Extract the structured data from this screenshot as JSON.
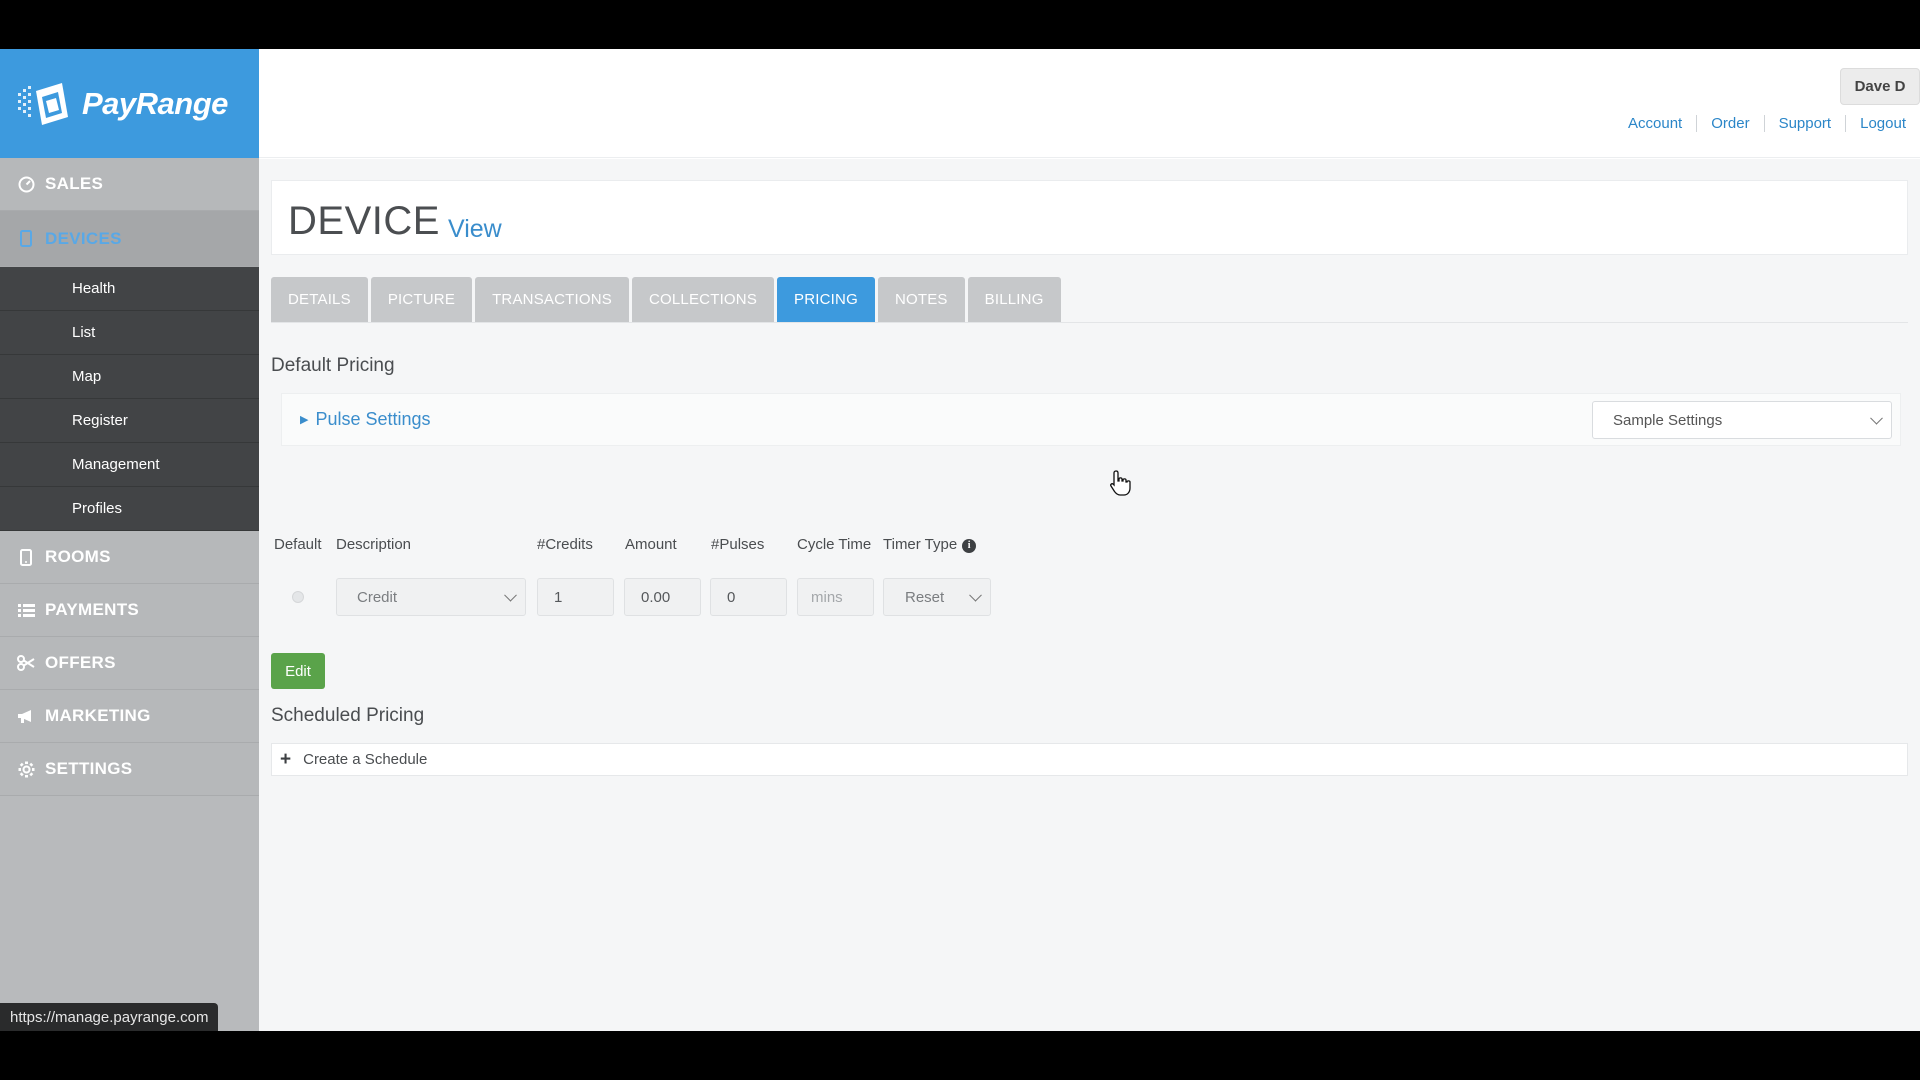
{
  "brand": {
    "name": "PayRange",
    "accent": "#3d9ade"
  },
  "sidebar": {
    "items": [
      {
        "label": "SALES",
        "icon": "dashboard-icon"
      },
      {
        "label": "DEVICES",
        "icon": "device-icon"
      },
      {
        "label": "ROOMS",
        "icon": "phone-icon"
      },
      {
        "label": "PAYMENTS",
        "icon": "list-icon"
      },
      {
        "label": "OFFERS",
        "icon": "scissors-icon"
      },
      {
        "label": "MARKETING",
        "icon": "megaphone-icon"
      },
      {
        "label": "SETTINGS",
        "icon": "gear-icon"
      }
    ],
    "active": "DEVICES",
    "sub_items": [
      "Health",
      "List",
      "Map",
      "Register",
      "Management",
      "Profiles"
    ]
  },
  "status_bar": {
    "url": "https://manage.payrange.com"
  },
  "header": {
    "user": "Dave D",
    "links": [
      "Account",
      "Order",
      "Support",
      "Logout"
    ]
  },
  "page": {
    "title": "DEVICE",
    "subtitle": "View",
    "tabs": [
      "DETAILS",
      "PICTURE",
      "TRANSACTIONS",
      "COLLECTIONS",
      "PRICING",
      "NOTES",
      "BILLING"
    ],
    "active_tab": "PRICING"
  },
  "default_pricing": {
    "heading": "Default Pricing",
    "pulse_settings": "Pulse Settings",
    "settings_select": "Sample Settings",
    "columns": [
      "Default",
      "Description",
      "#Credits",
      "Amount",
      "#Pulses",
      "Cycle Time",
      "Timer Type"
    ],
    "row": {
      "description": "Credit",
      "credits": "1",
      "amount": "0.00",
      "pulses": "0",
      "cycle_time_placeholder": "mins",
      "timer_type": "Reset"
    },
    "edit_label": "Edit"
  },
  "scheduled_pricing": {
    "heading": "Scheduled Pricing",
    "create_label": "Create a Schedule"
  }
}
